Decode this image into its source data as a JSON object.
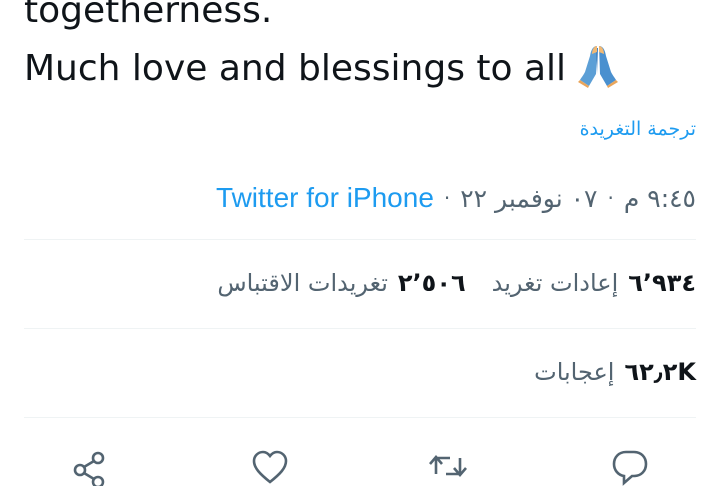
{
  "tweet": {
    "text_line_1": "togetherness.",
    "text_line_2": "Much love and blessings to all",
    "emoji": "folded-hands-icon"
  },
  "translate_label": "ترجمة التغريدة",
  "meta": {
    "time": "٩:٤٥ م",
    "date": "٠٧ نوفمبر ٢٢",
    "separator": "·",
    "source": "Twitter for iPhone"
  },
  "stats": {
    "retweets": {
      "count": "٦٬٩٣٤",
      "label": "إعادات تغريد"
    },
    "quotes": {
      "count": "٢٬٥٠٦",
      "label": "تغريدات الاقتباس"
    },
    "likes": {
      "count": "٦٢٫٢K",
      "label": "إعجابات"
    }
  },
  "actions": {
    "items": [
      "share-icon",
      "heart-icon",
      "retweet-icon",
      "reply-icon"
    ]
  },
  "colors": {
    "accent": "#1d9bf0",
    "text": "#0f1419",
    "secondary": "#536471",
    "divider": "#eff3f4"
  }
}
